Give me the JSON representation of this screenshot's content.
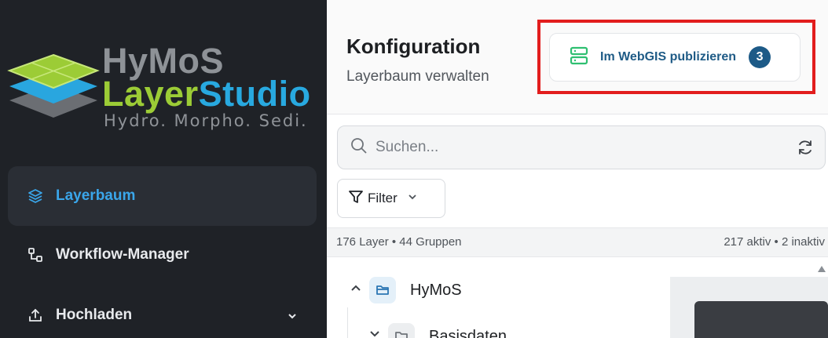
{
  "sidebar": {
    "logo": {
      "line1": "HyMoS",
      "line2_part1": "Layer",
      "line2_part2": "Studio",
      "tagline": "Hydro. Morpho. Sedi."
    },
    "nav": [
      {
        "label": "Layerbaum",
        "icon": "layers-icon",
        "active": true
      },
      {
        "label": "Workflow-Manager",
        "icon": "workflow-icon",
        "active": false
      },
      {
        "label": "Hochladen",
        "icon": "upload-icon",
        "active": false
      }
    ]
  },
  "header": {
    "title": "Konfiguration",
    "subtitle": "Layerbaum verwalten",
    "publish_button": {
      "label": "Im WebGIS publizieren",
      "badge": "3",
      "icon": "server-icon"
    }
  },
  "search": {
    "placeholder": "Suchen..."
  },
  "filter": {
    "label": "Filter"
  },
  "stats": {
    "left": "176 Layer • 44 Gruppen",
    "right": "217 aktiv • 2 inaktiv"
  },
  "tree": [
    {
      "label": "HyMoS",
      "expanded": true
    },
    {
      "label": "Basisdaten",
      "expanded": false
    }
  ],
  "colors": {
    "sidebar_bg": "#1f2227",
    "active_accent": "#3aa6ea",
    "highlight_border": "#e21d1d",
    "badge_bg": "#1d5a87",
    "publish_icon": "#2fbf71"
  }
}
